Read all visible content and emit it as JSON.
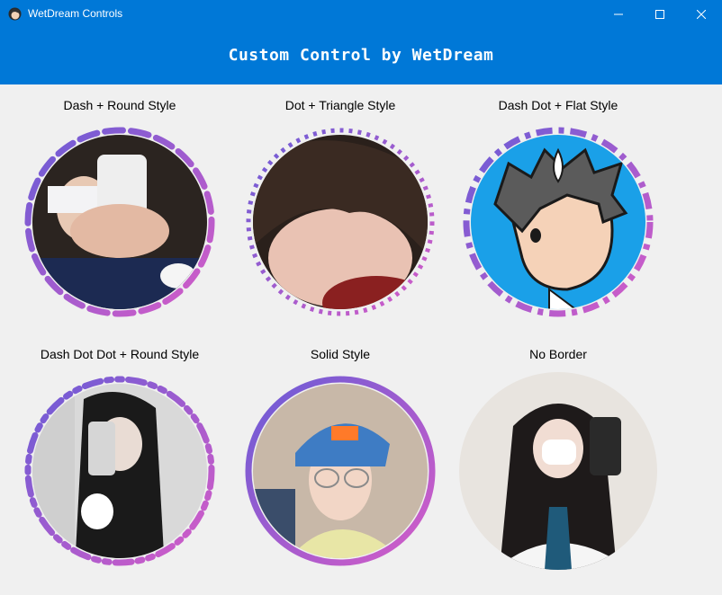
{
  "window": {
    "title": "WetDream Controls",
    "controls": [
      "minimize-icon",
      "maximize-icon",
      "close-icon"
    ]
  },
  "header": {
    "title": "Custom Control by WetDream"
  },
  "controls": [
    {
      "label": "Dash + Round Style"
    },
    {
      "label": "Dot + Triangle Style"
    },
    {
      "label": "Dash Dot + Flat Style"
    },
    {
      "label": "Dash Dot Dot + Round Style"
    },
    {
      "label": "Solid Style"
    },
    {
      "label": "No Border"
    }
  ],
  "colors": {
    "titlebar": "#0078d7",
    "border_start": "#6a5cd6",
    "border_end": "#d65cc7",
    "background": "#f0f0f0"
  }
}
